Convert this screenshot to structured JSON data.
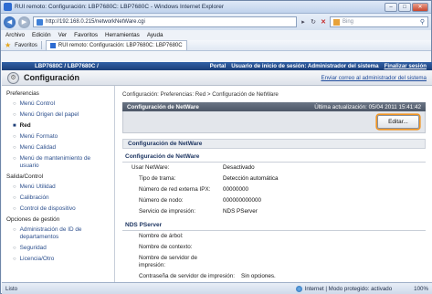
{
  "window": {
    "title": "RUI remoto: Configuración: LBP7680C: LBP7680C - Windows Internet Explorer"
  },
  "address": {
    "url": "http://192.168.0.215/networkNetWare.cgi",
    "search_placeholder": "Bing"
  },
  "menu": [
    "Archivo",
    "Edición",
    "Ver",
    "Favoritos",
    "Herramientas",
    "Ayuda"
  ],
  "favorites": {
    "label": "Favoritos",
    "tab_title": "RUI remoto: Configuración: LBP7680C: LBP7680C"
  },
  "topbar": {
    "device": "LBP7680C / LBP7680C /",
    "portal": "Portal",
    "user": "Usuario de inicio de sesión: Administrador del sistema",
    "logout": "Finalizar sesión"
  },
  "header": {
    "title": "Configuración",
    "mail_link": "Enviar correo al administrador del sistema"
  },
  "sidebar": {
    "groups": [
      {
        "heading": "Preferencias",
        "items": [
          {
            "label": "Menú Control",
            "active": false
          },
          {
            "label": "Menú Origen del papel",
            "active": false
          },
          {
            "label": "Red",
            "active": true
          },
          {
            "label": "Menú Formato",
            "active": false
          },
          {
            "label": "Menú Calidad",
            "active": false
          },
          {
            "label": "Menú de mantenimiento de usuario",
            "active": false
          }
        ]
      },
      {
        "heading": "Salida/Control",
        "items": [
          {
            "label": "Menú Utilidad",
            "active": false
          },
          {
            "label": "Calibración",
            "active": false
          },
          {
            "label": "Control de dispositivo",
            "active": false
          }
        ]
      },
      {
        "heading": "Opciones de gestión",
        "items": [
          {
            "label": "Administración de ID de departamentos",
            "active": false
          },
          {
            "label": "Seguridad",
            "active": false
          },
          {
            "label": "Licencia/Otro",
            "active": false
          }
        ]
      }
    ]
  },
  "content": {
    "breadcrumb": "Configuración: Preferencias: Red > Configuración de NetWare",
    "panel_title": "Configuración de NetWare",
    "last_update": "Última actualización: 05/04 2011 15:41:42",
    "edit_button": "Editar...",
    "section_title": "Configuración de NetWare",
    "subsection1": "Configuración de NetWare",
    "netware_rows": [
      {
        "k": "Usar NetWare:",
        "v": "Desactivado",
        "indent": false
      },
      {
        "k": "Tipo de trama:",
        "v": "Detección automática",
        "indent": true
      },
      {
        "k": "Número de red externa IPX:",
        "v": "00000000",
        "indent": true
      },
      {
        "k": "Número de nodo:",
        "v": "000000000000",
        "indent": true
      },
      {
        "k": "Servicio de impresión:",
        "v": "NDS PServer",
        "indent": true
      }
    ],
    "subsection2": "NDS PServer",
    "pserver_rows": [
      {
        "k": "Nombre de árbol:",
        "v": ""
      },
      {
        "k": "Nombre de contexto:",
        "v": ""
      },
      {
        "k": "Nombre de servidor de impresión:",
        "v": ""
      },
      {
        "k": "Contraseña de servidor de impresión:",
        "v": "Sin opciones."
      }
    ]
  },
  "status": {
    "left": "Listo",
    "zone": "Internet | Modo protegido: activado",
    "zoom": "100%"
  }
}
